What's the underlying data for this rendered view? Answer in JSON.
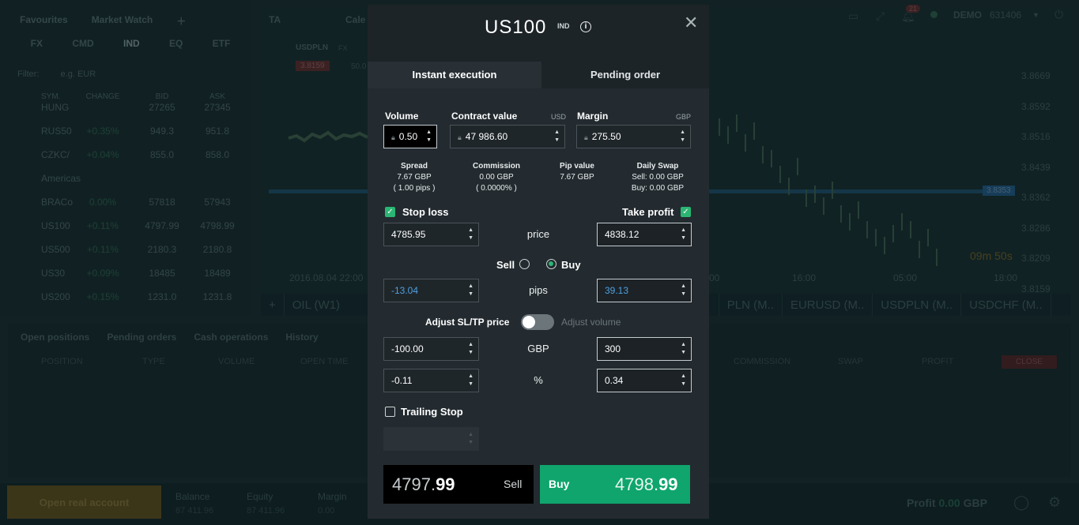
{
  "background": {
    "left_tabs": [
      "Favourites",
      "Market Watch"
    ],
    "categories": [
      "FX",
      "CMD",
      "IND",
      "EQ",
      "ETF"
    ],
    "filter_label": "Filter:",
    "filter_placeholder": "e.g. EUR",
    "columns": [
      "SYM.",
      "CHANGE",
      "BID",
      "ASK"
    ],
    "rows": [
      {
        "sym": "HUNG",
        "change": "",
        "bid": "27265",
        "ask": "27345"
      },
      {
        "sym": "RUS50",
        "change": "+0.35%",
        "bid": "949.3",
        "ask": "951.8"
      },
      {
        "sym": "CZKC/",
        "change": "+0.04%",
        "bid": "855.0",
        "ask": "858.0"
      },
      {
        "sym": "Americas",
        "change": "",
        "bid": "",
        "ask": ""
      },
      {
        "sym": "BRACo",
        "change": "0.00%",
        "bid": "57818",
        "ask": "57943"
      },
      {
        "sym": "US100",
        "change": "+0.11%",
        "bid": "4797.99",
        "ask": "4798.99"
      },
      {
        "sym": "US500",
        "change": "+0.11%",
        "bid": "2180.3",
        "ask": "2180.8"
      },
      {
        "sym": "US30",
        "change": "+0.09%",
        "bid": "18485",
        "ask": "18489"
      },
      {
        "sym": "US200",
        "change": "+0.15%",
        "bid": "1231.0",
        "ask": "1231.8"
      }
    ],
    "chart_tab": "TA",
    "chart_tab2": "Cale",
    "chart_symbol": "USDPLN",
    "chart_symbol_tag": "FX",
    "chart_price_tag": "3.8159",
    "chart_price_tag2": "50.0",
    "right_axis": [
      "3.8669",
      "3.8592",
      "3.8516",
      "3.8439",
      "3.8362",
      "3.8286",
      "3.8209",
      "3.8159"
    ],
    "current_line_label": "3.8353",
    "countdown": "09m 50s",
    "bottom_axis": [
      "2016.08.04 22:00",
      "00",
      "16:00",
      "05:00",
      "18:00"
    ],
    "bottom_tabs": [
      "OIL (W1)",
      "PLN (M..",
      "EURUSD (M..",
      "USDPLN (M..",
      "USDCHF (M.."
    ],
    "positions_tabs": [
      "Open positions",
      "Pending orders",
      "Cash operations",
      "History"
    ],
    "positions_headers": [
      "POSITION",
      "TYPE",
      "VOLUME",
      "OPEN TIME",
      "COMMISSION",
      "SWAP",
      "PROFIT"
    ],
    "close_label": "CLOSE",
    "open_real_account": "Open real account",
    "footer_labels": [
      "Balance",
      "Equity",
      "Margin"
    ],
    "footer_values": [
      "87 411.96",
      "87 411.96",
      "0.00"
    ],
    "profit_label": "Profit",
    "profit_value": "0.00",
    "profit_currency": "GBP",
    "account_mode": "DEMO",
    "account_number": "631406",
    "notifications_count": "21"
  },
  "modal": {
    "title": "US100",
    "tag": "IND",
    "tabs": [
      "Instant execution",
      "Pending order"
    ],
    "volume_label": "Volume",
    "volume_value": "0.50",
    "contract_label": "Contract value",
    "contract_unit": "USD",
    "contract_value": "47 986.60",
    "margin_label": "Margin",
    "margin_unit": "GBP",
    "margin_value": "275.50",
    "spread_label": "Spread",
    "spread_value": "7.67 GBP",
    "spread_pips": "( 1.00 pips )",
    "commission_label": "Commission",
    "commission_value": "0.00 GBP",
    "commission_pct": "( 0.0000% )",
    "pip_label": "Pip value",
    "pip_value": "7.67 GBP",
    "swap_label": "Daily Swap",
    "swap_sell": "Sell: 0.00 GBP",
    "swap_buy": "Buy: 0.00 GBP",
    "stop_loss_label": "Stop loss",
    "take_profit_label": "Take profit",
    "sl_price": "4785.95",
    "tp_price": "4838.12",
    "price_label": "price",
    "sell_radio": "Sell",
    "buy_radio": "Buy",
    "sl_pips": "-13.04",
    "tp_pips": "39.13",
    "pips_label": "pips",
    "adjust_sltp": "Adjust SL/TP price",
    "adjust_volume": "Adjust volume",
    "sl_gbp": "-100.00",
    "tp_gbp": "300",
    "gbp_label": "GBP",
    "sl_pct": "-0.11",
    "tp_pct": "0.34",
    "pct_label": "%",
    "trailing_label": "Trailing Stop",
    "sell_price_main": "4797.",
    "sell_price_bold": "99",
    "sell_label": "Sell",
    "buy_label": "Buy",
    "buy_price_main": "4798.",
    "buy_price_bold": "99"
  }
}
